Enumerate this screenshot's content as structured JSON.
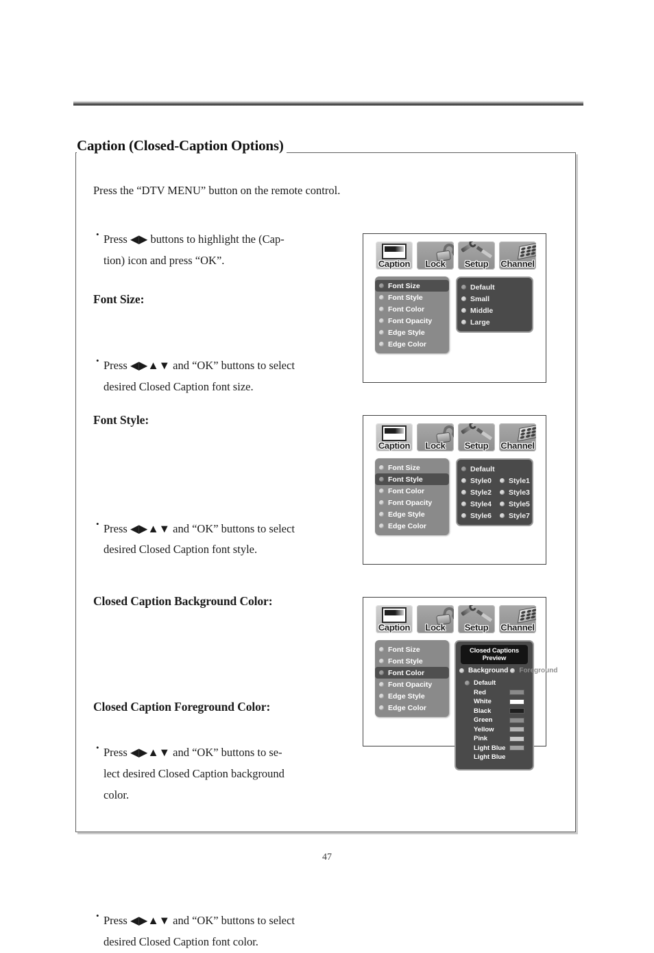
{
  "page": {
    "section_title": "Caption (Closed-Caption Options)",
    "intro": "Press the “DTV MENU” button on the remote control.",
    "page_number": "47"
  },
  "instructions": {
    "caption_bullet_line1": "Press ◀▶ buttons to highlight the (Cap-",
    "caption_bullet_line2": "tion) icon and press “OK”.",
    "font_size": {
      "heading": "Font Size:",
      "line1": "Press ◀▶▲▼ and “OK” buttons to select",
      "line2": "desired Closed Caption font size."
    },
    "font_style": {
      "heading": "Font Style:",
      "line1": "Press ◀▶▲▼ and “OK” buttons to select",
      "line2": "desired Closed Caption font style."
    },
    "background_color": {
      "heading": "Closed Caption Background Color:",
      "line1": "Press ◀▶▲▼ and “OK” buttons to se-",
      "line2": "lect desired Closed Caption background",
      "line3": "color."
    },
    "foreground_color": {
      "heading": "Closed Caption Foreground Color:",
      "line1": "Press ◀▶▲▼ and “OK” buttons to select",
      "line2": "desired Closed Caption font color."
    }
  },
  "osd_tabs": [
    {
      "label": "Caption",
      "icon": "caption-screen-icon",
      "active": true
    },
    {
      "label": "Lock",
      "icon": "padlock-icon",
      "active": false
    },
    {
      "label": "Setup",
      "icon": "screwdriver-wrench-icon",
      "active": false
    },
    {
      "label": "Channel",
      "icon": "remote-keypad-icon",
      "active": false
    }
  ],
  "caption_menu_items": [
    "Font Size",
    "Font Style",
    "Font Color",
    "Font Opacity",
    "Edge Style",
    "Edge Color"
  ],
  "osd1": {
    "selected_menu": "Font Size",
    "options": [
      "Default",
      "Small",
      "Middle",
      "Large"
    ]
  },
  "osd2": {
    "selected_menu": "Font Style",
    "default_option": "Default",
    "options": [
      "Style0",
      "Style1",
      "Style2",
      "Style3",
      "Style4",
      "Style5",
      "Style6",
      "Style7"
    ]
  },
  "osd3": {
    "selected_menu": "Font Color",
    "preview_label": "Closed Captions Preview",
    "background_label": "Background",
    "foreground_label": "Foreground",
    "default_label": "Default",
    "colors": [
      {
        "name": "Red",
        "swatch": "#8a8a8a"
      },
      {
        "name": "White",
        "swatch": "#ffffff"
      },
      {
        "name": "Black",
        "swatch": "#1e1e1e"
      },
      {
        "name": "Green",
        "swatch": "#8d8d8d"
      },
      {
        "name": "Yellow",
        "swatch": "#b4b4b4"
      },
      {
        "name": "Pink",
        "swatch": "#cacaca"
      },
      {
        "name": "Light Blue",
        "swatch": "#a2a2a2"
      },
      {
        "name": "Light Blue",
        "swatch": null
      }
    ]
  }
}
